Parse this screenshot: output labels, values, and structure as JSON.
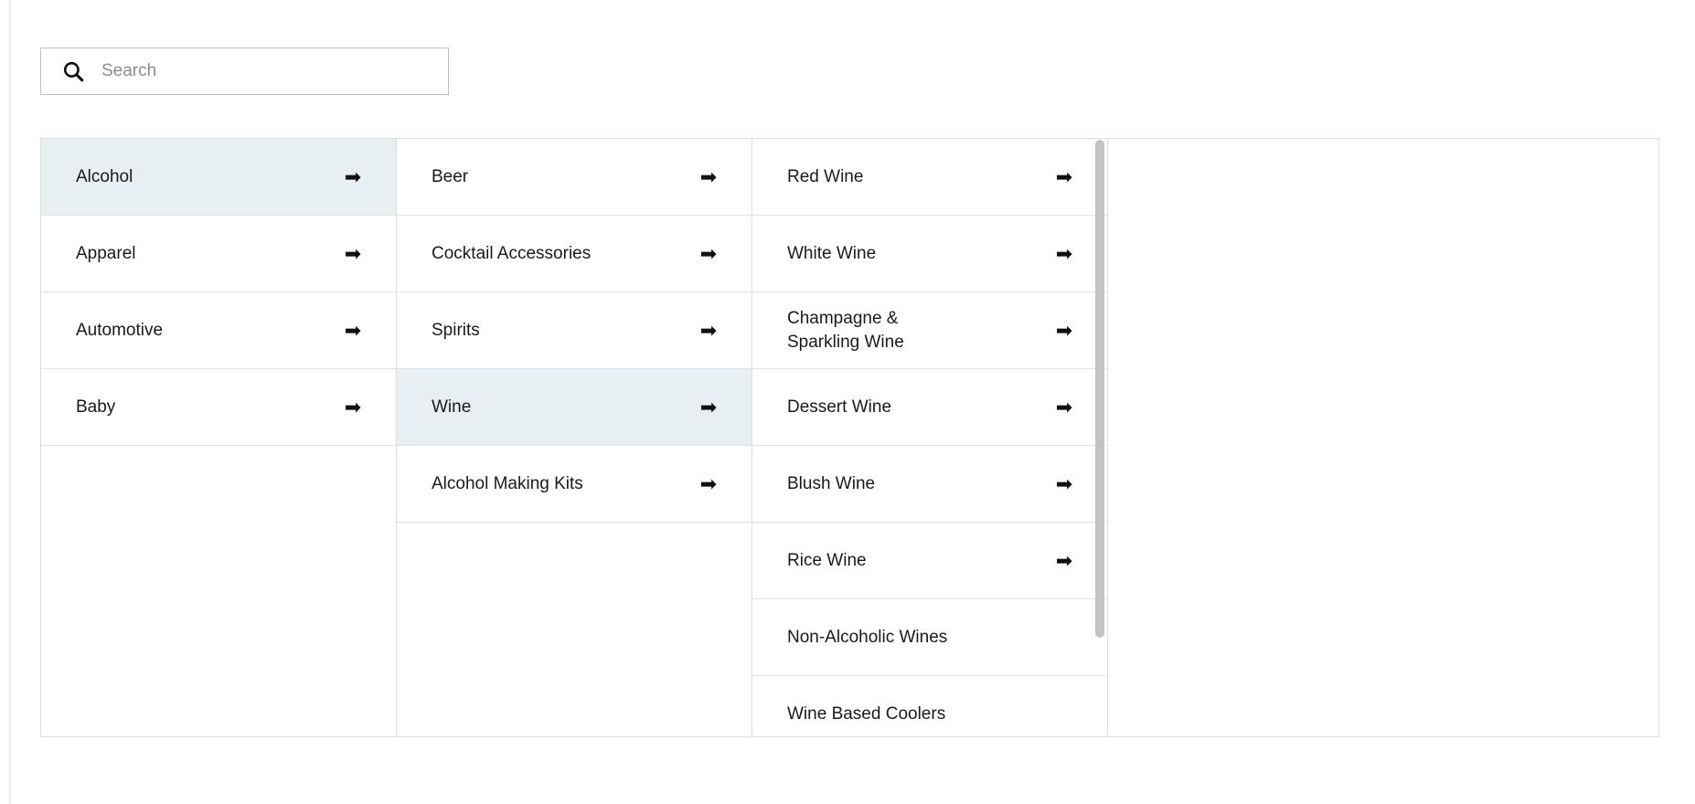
{
  "search": {
    "placeholder": "Search",
    "value": "",
    "icon": "search-icon"
  },
  "menu": {
    "arrow_glyph": "➡",
    "selected_background": "#e7eff2",
    "border_color": "#dddddd",
    "columns": [
      {
        "name": "categories",
        "items": [
          {
            "label": "Alcohol",
            "has_arrow": true,
            "selected": true
          },
          {
            "label": "Apparel",
            "has_arrow": true,
            "selected": false
          },
          {
            "label": "Automotive",
            "has_arrow": true,
            "selected": false
          },
          {
            "label": "Baby",
            "has_arrow": true,
            "selected": false
          }
        ]
      },
      {
        "name": "alcohol-subcategories",
        "items": [
          {
            "label": "Beer",
            "has_arrow": true,
            "selected": false
          },
          {
            "label": "Cocktail Accessories",
            "has_arrow": true,
            "selected": false
          },
          {
            "label": "Spirits",
            "has_arrow": true,
            "selected": false
          },
          {
            "label": "Wine",
            "has_arrow": true,
            "selected": true
          },
          {
            "label": "Alcohol Making Kits",
            "has_arrow": true,
            "selected": false
          }
        ]
      },
      {
        "name": "wine-subcategories",
        "scrollable": true,
        "items": [
          {
            "label": "Red Wine",
            "has_arrow": true,
            "selected": false
          },
          {
            "label": "White Wine",
            "has_arrow": true,
            "selected": false
          },
          {
            "label": "Champagne &\nSparkling Wine",
            "has_arrow": true,
            "selected": false
          },
          {
            "label": "Dessert Wine",
            "has_arrow": true,
            "selected": false
          },
          {
            "label": "Blush Wine",
            "has_arrow": true,
            "selected": false
          },
          {
            "label": "Rice Wine",
            "has_arrow": true,
            "selected": false
          },
          {
            "label": "Non-Alcoholic Wines",
            "has_arrow": false,
            "selected": false
          },
          {
            "label": "Wine Based Coolers",
            "has_arrow": false,
            "selected": false
          }
        ]
      },
      {
        "name": "empty-panel",
        "items": []
      }
    ]
  }
}
